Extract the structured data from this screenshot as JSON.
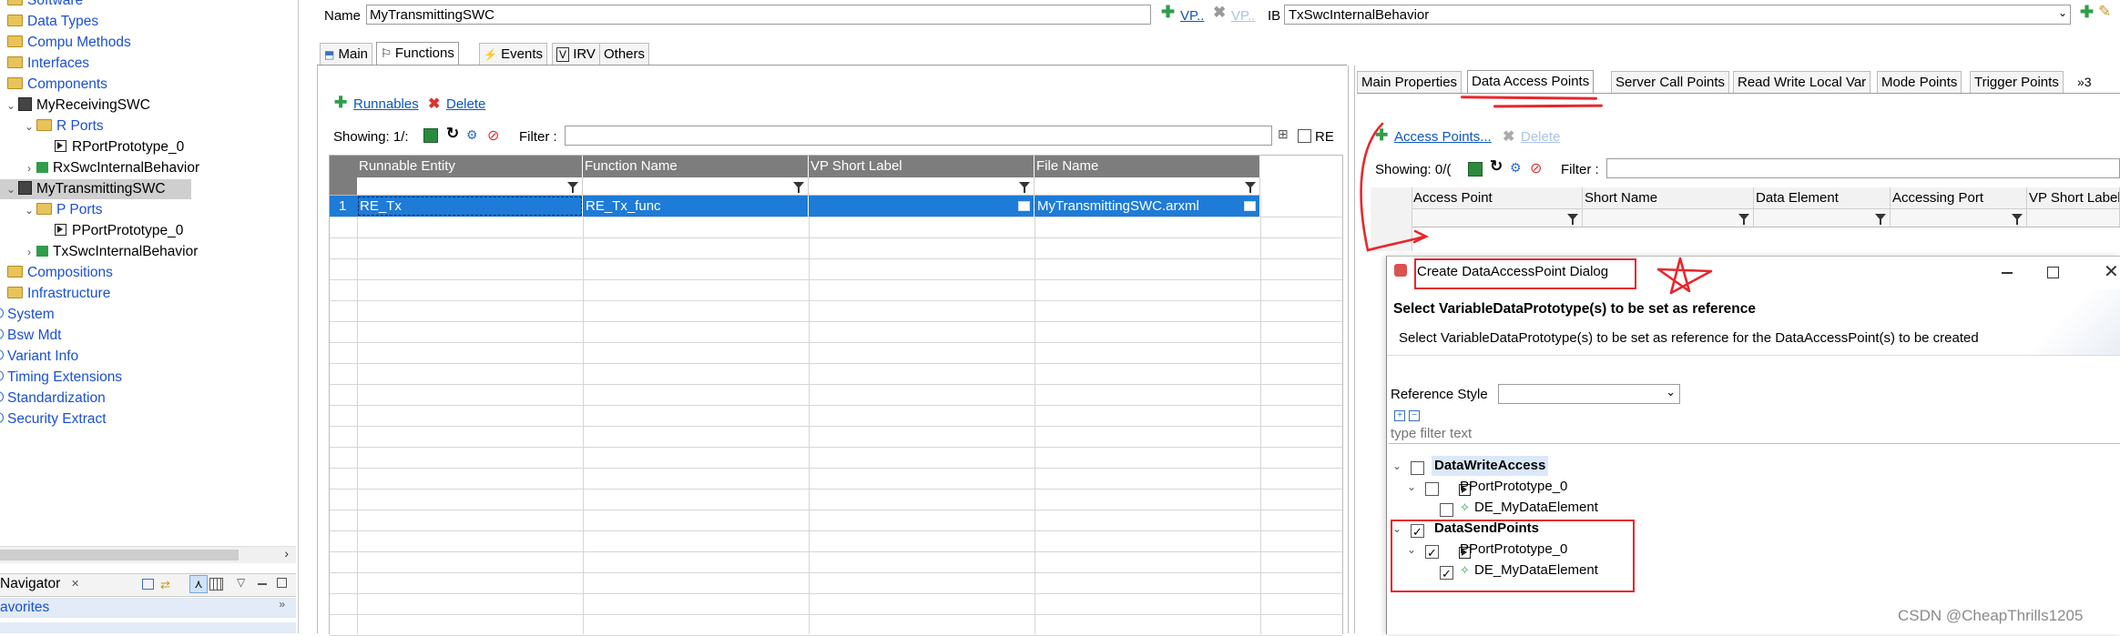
{
  "left_tree": {
    "items": [
      {
        "label": "Software",
        "indent": 0,
        "icon": "folder-icon",
        "cut": true
      },
      {
        "label": "Data Types",
        "indent": 0,
        "icon": "folder-icon"
      },
      {
        "label": "Compu Methods",
        "indent": 0,
        "icon": "folder-icon"
      },
      {
        "label": "Interfaces",
        "indent": 0,
        "icon": "folder-icon"
      },
      {
        "label": "Components",
        "indent": 0,
        "icon": "folder-icon"
      },
      {
        "label": "MyReceivingSWC",
        "indent": 1,
        "icon": "swc-icon",
        "expander": "v"
      },
      {
        "label": "R Ports",
        "indent": 2,
        "icon": "folder-icon",
        "expander": "v"
      },
      {
        "label": "RPortPrototype_0",
        "indent": 3,
        "icon": "port-icon"
      },
      {
        "label": "RxSwcInternalBehavior",
        "indent": 2,
        "icon": "internal-behavior-icon",
        "expander": ">"
      },
      {
        "label": "MyTransmittingSWC",
        "indent": 1,
        "icon": "swc-icon",
        "expander": "v",
        "selected": true
      },
      {
        "label": "P Ports",
        "indent": 2,
        "icon": "folder-icon",
        "expander": "v"
      },
      {
        "label": "PPortPrototype_0",
        "indent": 3,
        "icon": "port-icon"
      },
      {
        "label": "TxSwcInternalBehavior",
        "indent": 2,
        "icon": "internal-behavior-icon",
        "expander": ">"
      },
      {
        "label": "Compositions",
        "indent": 0,
        "icon": "folder-icon"
      },
      {
        "label": "Infrastructure",
        "indent": 0,
        "icon": "folder-icon"
      },
      {
        "label": "System",
        "indent": -1
      },
      {
        "label": "Bsw Mdt",
        "indent": -1
      },
      {
        "label": "Variant Info",
        "indent": -1
      },
      {
        "label": "Timing Extensions",
        "indent": -1
      },
      {
        "label": "Standardization",
        "indent": -1
      },
      {
        "label": "Security Extract",
        "indent": -1
      }
    ]
  },
  "navigator": {
    "title": "Navigator",
    "close": "✕",
    "favorites": "avorites"
  },
  "editor": {
    "name_label": "Name",
    "name_value": "MyTransmittingSWC",
    "vp_link": "VP..",
    "vp_link2": "VP..",
    "ib_label": "IB",
    "ib_value": "TxSwcInternalBehavior",
    "tabs": [
      "Main",
      "Functions",
      "Events",
      "IRV",
      "Others"
    ]
  },
  "runnables": {
    "runnables_link": "Runnables",
    "delete_link": "Delete",
    "showing": "Showing: 1/:",
    "filter_label": "Filter :",
    "re_label": "RE",
    "columns": [
      "Runnable Entity",
      "Function Name",
      "VP Short Label",
      "File Name"
    ],
    "rows": [
      [
        "1",
        "RE_Tx",
        "RE_Tx_func",
        "",
        "MyTransmittingSWC.arxml"
      ]
    ]
  },
  "right_panel": {
    "tabs": [
      "Main Properties",
      "Data Access Points",
      "Server Call Points",
      "Read Write Local Var",
      "Mode Points",
      "Trigger Points",
      "»3"
    ],
    "access_points_link": "Access Points...",
    "delete_link": "Delete",
    "showing": "Showing: 0/(",
    "filter_label": "Filter :",
    "columns": [
      "Access Point",
      "Short Name",
      "Data Element",
      "Accessing Port",
      "VP Short Label"
    ]
  },
  "dialog": {
    "title": "Create DataAccessPoint Dialog",
    "heading": "Select VariableDataPrototype(s) to be set as reference",
    "description": "Select VariableDataPrototype(s) to be set as reference for the DataAccessPoint(s) to be created",
    "reference_style_label": "Reference Style",
    "filter_placeholder": "type filter text",
    "tree": [
      {
        "label": "DataWriteAccess",
        "level": 0,
        "checked": false,
        "bold": true,
        "highlight": true
      },
      {
        "label": "PPortPrototype_0",
        "level": 1,
        "checked": false
      },
      {
        "label": "DE_MyDataElement",
        "level": 2,
        "checked": false
      },
      {
        "label": "DataSendPoints",
        "level": 0,
        "checked": true,
        "bold": true
      },
      {
        "label": "PPortPrototype_0",
        "level": 1,
        "checked": true
      },
      {
        "label": "DE_MyDataElement",
        "level": 2,
        "checked": true
      }
    ]
  },
  "watermark": "CSDN @CheapThrills1205",
  "colors": {
    "annotation_red": "#e8262b",
    "header_gray": "#7d7d7d",
    "selection_blue": "#1e7bd8",
    "link_blue": "#0b55c4"
  }
}
